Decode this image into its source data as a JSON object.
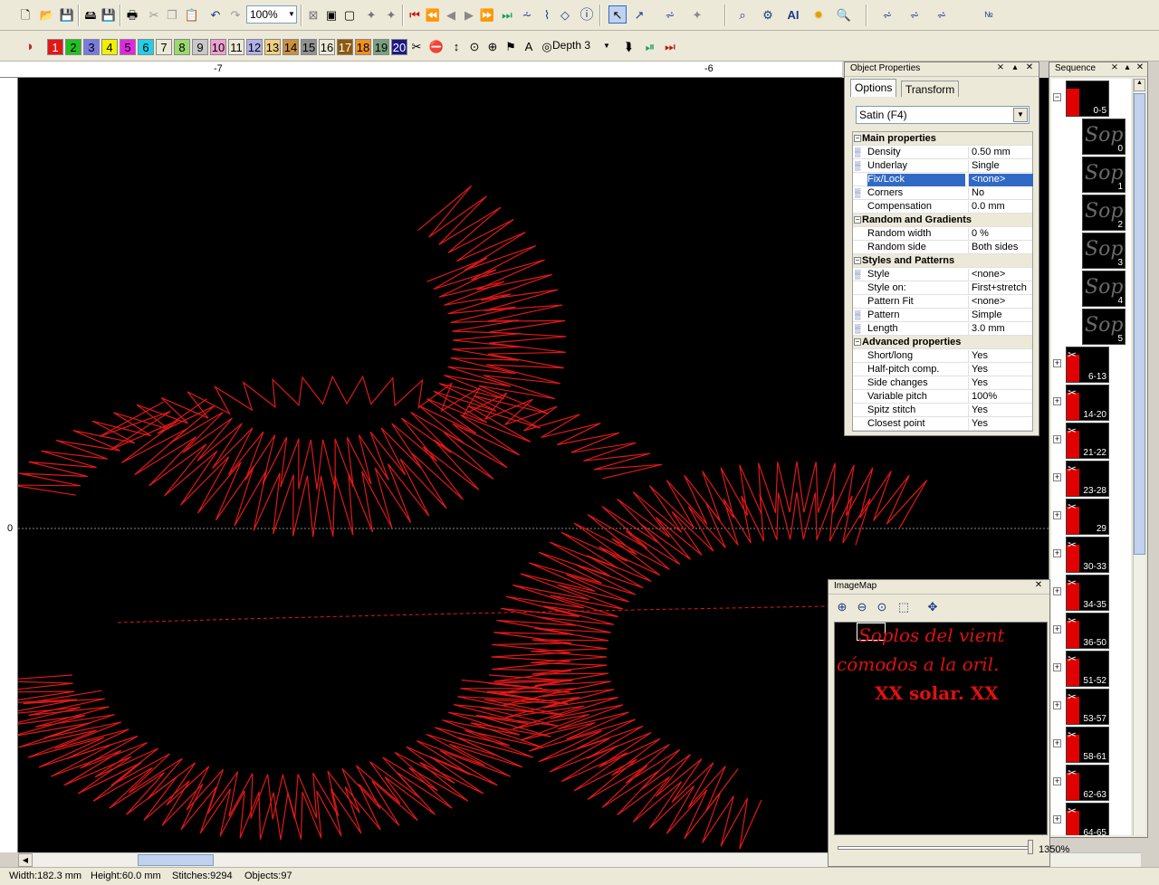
{
  "toolbar": {
    "zoom": "100%",
    "depth": "Depth 3",
    "color_buttons": [
      {
        "label": "1",
        "color": "#e01818"
      },
      {
        "label": "2",
        "color": "#22c022"
      },
      {
        "label": "3",
        "color": "#7a7ae0"
      },
      {
        "label": "4",
        "color": "#f0f000"
      },
      {
        "label": "5",
        "color": "#e028e0"
      },
      {
        "label": "6",
        "color": "#20d0e8"
      },
      {
        "label": "7",
        "color": "#ece9d8"
      },
      {
        "label": "8",
        "color": "#9ad870"
      },
      {
        "label": "9",
        "color": "#c8c8c8"
      },
      {
        "label": "10",
        "color": "#f0a0d0"
      },
      {
        "label": "11",
        "color": "#ece9d8"
      },
      {
        "label": "12",
        "color": "#b0b0e8"
      },
      {
        "label": "13",
        "color": "#f0d080"
      },
      {
        "label": "14",
        "color": "#c89040"
      },
      {
        "label": "15",
        "color": "#909090"
      },
      {
        "label": "16",
        "color": "#ece9d8"
      },
      {
        "label": "17",
        "color": "#8b5a10"
      },
      {
        "label": "18",
        "color": "#f09020"
      },
      {
        "label": "19",
        "color": "#7aa080"
      },
      {
        "label": "20",
        "color": "#1a1a80"
      }
    ]
  },
  "ruler": {
    "top_labels": [
      "-7",
      "-6"
    ],
    "left_label": "0"
  },
  "object_properties": {
    "title": "Object Properties",
    "tabs": [
      "Options",
      "Transform"
    ],
    "stitch_type": "Satin (F4)",
    "rows": [
      {
        "type": "cat",
        "name": "Main properties"
      },
      {
        "type": "prop",
        "name": "Density",
        "value": "0.50 mm",
        "icon": "density-icon"
      },
      {
        "type": "prop",
        "name": "Underlay",
        "value": "Single",
        "icon": "underlay-icon"
      },
      {
        "type": "prop",
        "name": "Fix/Lock",
        "value": "<none>",
        "selected": true
      },
      {
        "type": "prop",
        "name": "Corners",
        "value": "No",
        "icon": "corners-icon"
      },
      {
        "type": "prop",
        "name": "Compensation",
        "value": "0.0 mm"
      },
      {
        "type": "cat",
        "name": "Random and Gradients"
      },
      {
        "type": "prop",
        "name": "Random width",
        "value": "0 %"
      },
      {
        "type": "prop",
        "name": "Random side",
        "value": "Both sides"
      },
      {
        "type": "cat",
        "name": "Styles and Patterns"
      },
      {
        "type": "prop",
        "name": "Style",
        "value": "<none>",
        "icon": "style-icon"
      },
      {
        "type": "prop",
        "name": "Style on:",
        "value": "First+stretch"
      },
      {
        "type": "prop",
        "name": "Pattern Fit",
        "value": "<none>"
      },
      {
        "type": "prop",
        "name": "Pattern",
        "value": "Simple",
        "icon": "pattern-icon"
      },
      {
        "type": "prop",
        "name": "Length",
        "value": "3.0 mm",
        "icon": "length-icon"
      },
      {
        "type": "cat",
        "name": "Advanced properties"
      },
      {
        "type": "prop",
        "name": "Short/long",
        "value": "Yes"
      },
      {
        "type": "prop",
        "name": "Half-pitch comp.",
        "value": "Yes"
      },
      {
        "type": "prop",
        "name": "Side changes",
        "value": "Yes"
      },
      {
        "type": "prop",
        "name": "Variable pitch",
        "value": "100%"
      },
      {
        "type": "prop",
        "name": "Spitz stitch",
        "value": "Yes"
      },
      {
        "type": "prop",
        "name": "Closest point",
        "value": "Yes"
      }
    ]
  },
  "sequence": {
    "title": "Sequence",
    "items": [
      {
        "label": "0-5",
        "kind": "group-open"
      },
      {
        "label": "0",
        "kind": "child"
      },
      {
        "label": "1",
        "kind": "child"
      },
      {
        "label": "2",
        "kind": "child"
      },
      {
        "label": "3",
        "kind": "child"
      },
      {
        "label": "4",
        "kind": "child"
      },
      {
        "label": "5",
        "kind": "child"
      },
      {
        "label": "6-13",
        "kind": "group"
      },
      {
        "label": "14-20",
        "kind": "group"
      },
      {
        "label": "21-22",
        "kind": "group"
      },
      {
        "label": "23-28",
        "kind": "group"
      },
      {
        "label": "29",
        "kind": "group"
      },
      {
        "label": "30-33",
        "kind": "group"
      },
      {
        "label": "34-35",
        "kind": "group"
      },
      {
        "label": "36-50",
        "kind": "group"
      },
      {
        "label": "51-52",
        "kind": "group"
      },
      {
        "label": "53-57",
        "kind": "group"
      },
      {
        "label": "58-61",
        "kind": "group"
      },
      {
        "label": "62-63",
        "kind": "group"
      },
      {
        "label": "64-65",
        "kind": "group"
      }
    ],
    "child_glyph": "Sop"
  },
  "imagemap": {
    "title": "ImageMap",
    "lines": [
      "Soplos del vient",
      "cómodos a la oril.",
      "XX solar. XX"
    ],
    "zoom": "1350%"
  },
  "status": {
    "width": "Width:182.3 mm",
    "height": "Height:60.0 mm",
    "stitches": "Stitches:9294",
    "objects": "Objects:97"
  }
}
